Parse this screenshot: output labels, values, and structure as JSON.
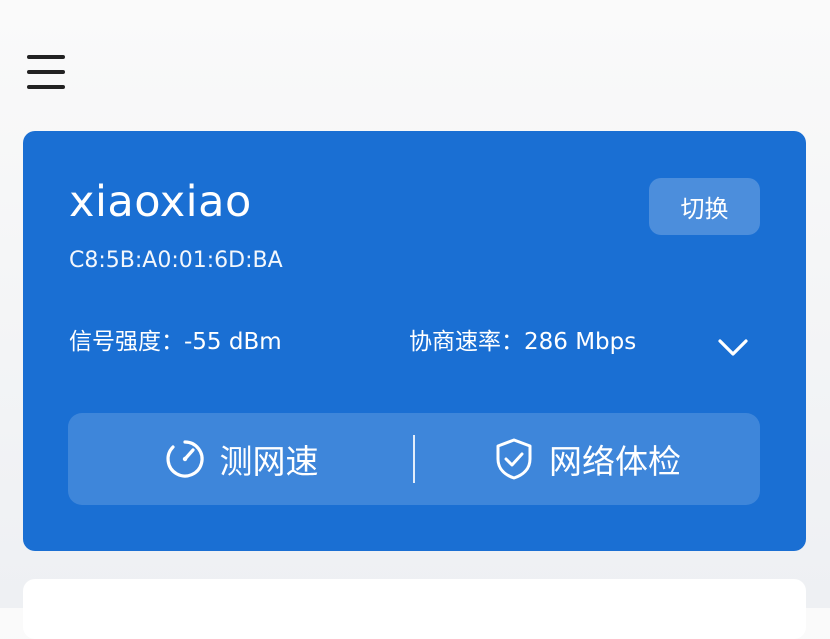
{
  "wifi": {
    "ssid": "xiaoxiao",
    "mac": "C8:5B:A0:01:6D:BA",
    "switch_label": "切换",
    "signal_label": "信号强度：-55 dBm",
    "rate_label": "协商速率：286 Mbps"
  },
  "actions": {
    "speed_test": "测网速",
    "health_check": "网络体检"
  },
  "colors": {
    "card_background": "#1a6fd3",
    "page_background": "#fafafa"
  },
  "icons": {
    "menu": "menu-icon",
    "expand": "chevron-down-icon",
    "speed_test": "speedometer-icon",
    "health_check": "shield-check-icon"
  }
}
